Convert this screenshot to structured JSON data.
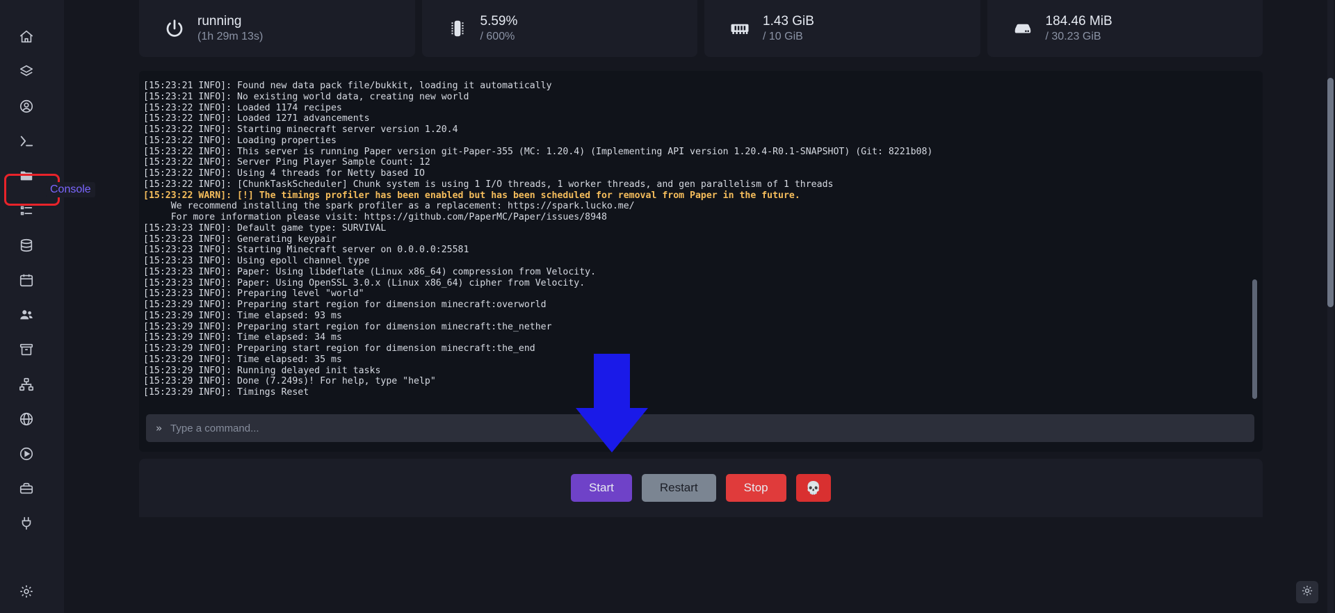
{
  "sidebar": {
    "items": [
      {
        "name": "home",
        "icon": "home-icon"
      },
      {
        "name": "servers",
        "icon": "layers-icon"
      },
      {
        "name": "account",
        "icon": "user-circle-icon"
      },
      {
        "name": "console",
        "icon": "terminal-icon",
        "label": "Console",
        "highlighted": true
      },
      {
        "name": "files",
        "icon": "folder-icon"
      },
      {
        "name": "tasks",
        "icon": "list-check-icon"
      },
      {
        "name": "databases",
        "icon": "database-icon"
      },
      {
        "name": "schedules",
        "icon": "calendar-icon"
      },
      {
        "name": "users",
        "icon": "users-icon"
      },
      {
        "name": "backups",
        "icon": "archive-icon"
      },
      {
        "name": "network",
        "icon": "network-icon"
      },
      {
        "name": "domains",
        "icon": "globe-icon"
      },
      {
        "name": "startup",
        "icon": "play-circle-icon"
      },
      {
        "name": "tools",
        "icon": "toolbox-icon"
      },
      {
        "name": "plugins",
        "icon": "plug-icon"
      },
      {
        "name": "settings",
        "icon": "gear-icon"
      }
    ]
  },
  "stats": [
    {
      "icon": "power-icon",
      "primary": "running",
      "secondary": "(1h 29m 13s)",
      "name": "status-card"
    },
    {
      "icon": "cpu-icon",
      "primary": "5.59%",
      "secondary": "/ 600%",
      "name": "cpu-card"
    },
    {
      "icon": "memory-icon",
      "primary": "1.43 GiB",
      "secondary": "/ 10 GiB",
      "name": "memory-card"
    },
    {
      "icon": "disk-icon",
      "primary": "184.46 MiB",
      "secondary": "/ 30.23 GiB",
      "name": "disk-card"
    }
  ],
  "console": {
    "lines": [
      {
        "text": "[15:23:21 INFO]: Found new data pack file/bukkit, loading it automatically",
        "style": "info"
      },
      {
        "text": "[15:23:21 INFO]: No existing world data, creating new world",
        "style": "info"
      },
      {
        "text": "[15:23:22 INFO]: Loaded 1174 recipes",
        "style": "info"
      },
      {
        "text": "[15:23:22 INFO]: Loaded 1271 advancements",
        "style": "info"
      },
      {
        "text": "[15:23:22 INFO]: Starting minecraft server version 1.20.4",
        "style": "info"
      },
      {
        "text": "[15:23:22 INFO]: Loading properties",
        "style": "info"
      },
      {
        "text": "[15:23:22 INFO]: This server is running Paper version git-Paper-355 (MC: 1.20.4) (Implementing API version 1.20.4-R0.1-SNAPSHOT) (Git: 8221b08)",
        "style": "info"
      },
      {
        "text": "[15:23:22 INFO]: Server Ping Player Sample Count: 12",
        "style": "info"
      },
      {
        "text": "[15:23:22 INFO]: Using 4 threads for Netty based IO",
        "style": "info"
      },
      {
        "text": "[15:23:22 INFO]: [ChunkTaskScheduler] Chunk system is using 1 I/O threads, 1 worker threads, and gen parallelism of 1 threads",
        "style": "info"
      },
      {
        "text": "[15:23:22 WARN]: [!] The timings profiler has been enabled but has been scheduled for removal from Paper in the future.",
        "style": "warn"
      },
      {
        "text": "     We recommend installing the spark profiler as a replacement: https://spark.lucko.me/",
        "style": "warncont"
      },
      {
        "text": "     For more information please visit: https://github.com/PaperMC/Paper/issues/8948",
        "style": "warncont"
      },
      {
        "text": "[15:23:23 INFO]: Default game type: SURVIVAL",
        "style": "info"
      },
      {
        "text": "[15:23:23 INFO]: Generating keypair",
        "style": "info"
      },
      {
        "text": "[15:23:23 INFO]: Starting Minecraft server on 0.0.0.0:25581",
        "style": "info"
      },
      {
        "text": "[15:23:23 INFO]: Using epoll channel type",
        "style": "info"
      },
      {
        "text": "[15:23:23 INFO]: Paper: Using libdeflate (Linux x86_64) compression from Velocity.",
        "style": "info"
      },
      {
        "text": "[15:23:23 INFO]: Paper: Using OpenSSL 3.0.x (Linux x86_64) cipher from Velocity.",
        "style": "info"
      },
      {
        "text": "[15:23:23 INFO]: Preparing level \"world\"",
        "style": "info"
      },
      {
        "text": "[15:23:29 INFO]: Preparing start region for dimension minecraft:overworld",
        "style": "info"
      },
      {
        "text": "[15:23:29 INFO]: Time elapsed: 93 ms",
        "style": "info"
      },
      {
        "text": "[15:23:29 INFO]: Preparing start region for dimension minecraft:the_nether",
        "style": "info"
      },
      {
        "text": "[15:23:29 INFO]: Time elapsed: 34 ms",
        "style": "info"
      },
      {
        "text": "[15:23:29 INFO]: Preparing start region for dimension minecraft:the_end",
        "style": "info"
      },
      {
        "text": "[15:23:29 INFO]: Time elapsed: 35 ms",
        "style": "info"
      },
      {
        "text": "[15:23:29 INFO]: Running delayed init tasks",
        "style": "info"
      },
      {
        "text": "[15:23:29 INFO]: Done (7.249s)! For help, type \"help\"",
        "style": "info"
      },
      {
        "text": "[15:23:29 INFO]: Timings Reset",
        "style": "info"
      }
    ],
    "prompt": "»",
    "input_value": "",
    "input_placeholder": "Type a command..."
  },
  "actions": {
    "start": "Start",
    "restart": "Restart",
    "stop": "Stop",
    "kill": "💀"
  },
  "colors": {
    "accent_purple": "#6f42c8",
    "stop_red": "#e03b3b",
    "warn_amber": "#f5bd5c",
    "highlight_red": "#e8232a",
    "annotation_blue": "#1a1ae8",
    "tooltip_purple": "#7b66ff"
  }
}
